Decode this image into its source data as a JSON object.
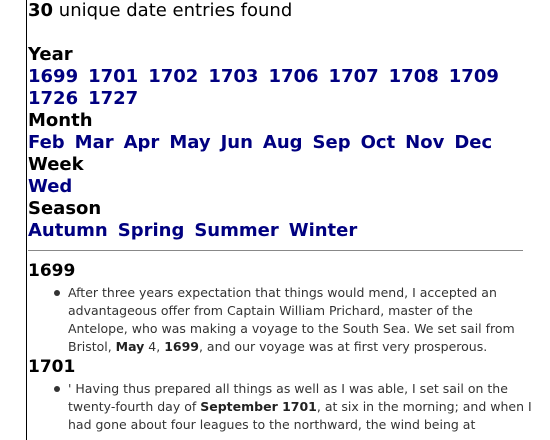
{
  "summary": {
    "count": "30",
    "text": "unique date entries found"
  },
  "facets": {
    "year": {
      "label": "Year",
      "items": [
        "1699",
        "1701",
        "1702",
        "1703",
        "1706",
        "1707",
        "1708",
        "1709",
        "1726",
        "1727"
      ]
    },
    "month": {
      "label": "Month",
      "items": [
        "Feb",
        "Mar",
        "Apr",
        "May",
        "Jun",
        "Aug",
        "Sep",
        "Oct",
        "Nov",
        "Dec"
      ]
    },
    "week": {
      "label": "Week",
      "items": [
        "Wed"
      ]
    },
    "season": {
      "label": "Season",
      "items": [
        "Autumn",
        "Spring",
        "Summer",
        "Winter"
      ]
    }
  },
  "results": [
    {
      "year": "1699",
      "entry": {
        "t1": "After three years expectation that things would mend, I accepted an advantageous offer from Captain William Prichard, master of the Antelope, who was making a voyage to the South Sea. We set sail from Bristol, ",
        "b1": "May",
        "t2": " 4, ",
        "b2": "1699",
        "t3": ", and our voyage was at first very prosperous."
      }
    },
    {
      "year": "1701",
      "entry": {
        "t1": "' Having thus prepared all things as well as I was able, I set sail on the twenty-fourth day of ",
        "b1": "September 1701",
        "t2": ", at six in the morning; and when I had gone about four leagues to the northward, the wind being at",
        "b2": "",
        "t3": ""
      }
    }
  ],
  "colors": {
    "link": "#000080",
    "text": "#333333",
    "divider": "#888888"
  }
}
